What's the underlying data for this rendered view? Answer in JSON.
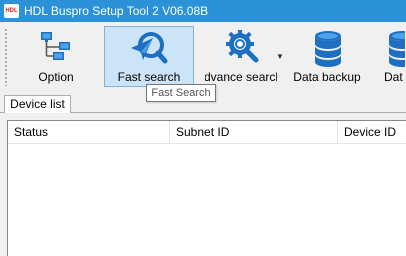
{
  "window": {
    "logo_text": "HDL",
    "title": "HDL Buspro Setup Tool 2 V06.08B"
  },
  "toolbar": {
    "items": [
      {
        "label": "Option",
        "icon": "network-icon"
      },
      {
        "label": "Fast search",
        "icon": "fast-search-icon",
        "active": true
      },
      {
        "label": "Advance search",
        "icon": "advanced-search-gear-icon",
        "has_dropdown": true
      },
      {
        "label": "Data backup",
        "icon": "database-icon"
      },
      {
        "label": "Dat",
        "icon": "database-icon"
      }
    ]
  },
  "tooltip": {
    "text": "Fast Search"
  },
  "tabs": [
    {
      "label": "Device list"
    }
  ],
  "table": {
    "columns": [
      "Status",
      "Subnet ID",
      "Device ID"
    ],
    "rows": []
  },
  "colors": {
    "titlebar": "#2b92d8",
    "accent_blue": "#1f6fc0",
    "active_button": "#cce4f7"
  }
}
